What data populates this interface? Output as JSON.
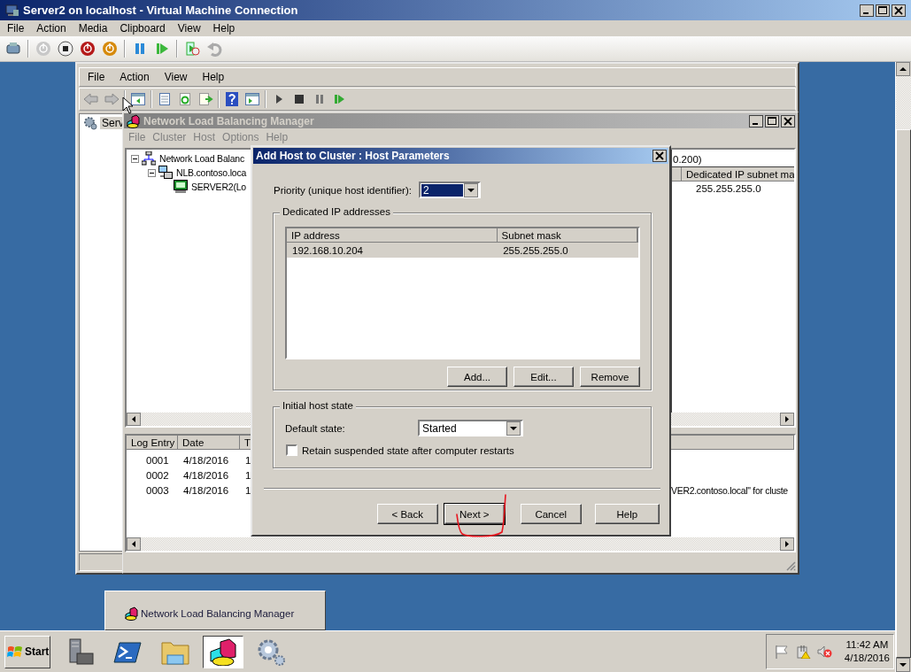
{
  "vm_window": {
    "title": "Server2 on localhost - Virtual Machine Connection",
    "menu": [
      "File",
      "Action",
      "Media",
      "Clipboard",
      "View",
      "Help"
    ]
  },
  "mmc": {
    "menu": [
      "File",
      "Action",
      "View",
      "Help"
    ],
    "tree_item": "Serv"
  },
  "nlb": {
    "title": "Network Load Balancing Manager",
    "menu": [
      "File",
      "Cluster",
      "Host",
      "Options",
      "Help"
    ],
    "tree": [
      {
        "label": "Network Load Balanc",
        "kind": "root",
        "expanded": true,
        "children": [
          {
            "label": "NLB.contoso.loca",
            "kind": "cluster",
            "expanded": true,
            "children": [
              {
                "label": "SERVER2(Lo",
                "kind": "host"
              }
            ]
          }
        ]
      }
    ],
    "detail_caption": "0.200)",
    "detail_column": "Dedicated IP subnet ma",
    "detail_value": "255.255.255.0",
    "log_columns": [
      "Log Entry",
      "Date",
      "T"
    ],
    "log_rows": [
      {
        "entry": "0001",
        "date": "4/18/2016",
        "time": "1"
      },
      {
        "entry": "0002",
        "date": "4/18/2016",
        "time": "1"
      },
      {
        "entry": "0003",
        "date": "4/18/2016",
        "time": "1",
        "message": "VER2.contoso.local\" for cluste"
      }
    ]
  },
  "dialog": {
    "title": "Add Host to Cluster :  Host Parameters",
    "priority_label": "Priority (unique host identifier):",
    "priority_value": "2",
    "dedicated_group": "Dedicated IP addresses",
    "ip_columns": [
      "IP address",
      "Subnet mask"
    ],
    "ip_rows": [
      {
        "ip": "192.168.10.204",
        "mask": "255.255.255.0",
        "selected": true
      }
    ],
    "list_buttons": [
      "Add...",
      "Edit...",
      "Remove"
    ],
    "state_group": "Initial host state",
    "default_state_label": "Default state:",
    "default_state": "Started",
    "retain": {
      "label": "Retain suspended state after computer restarts",
      "checked": false
    },
    "buttons": [
      {
        "label": "< Back",
        "default": false
      },
      {
        "label": "Next >",
        "default": true
      },
      {
        "label": "Cancel",
        "default": false
      },
      {
        "label": "Help",
        "default": false
      }
    ]
  },
  "taskbar": {
    "thumbnail": "Network Load Balancing Manager",
    "start": "Start",
    "apps": [
      {
        "kind": "server",
        "selected": false
      },
      {
        "kind": "powershell",
        "selected": false
      },
      {
        "kind": "folder",
        "selected": false
      },
      {
        "kind": "nlb",
        "selected": true
      },
      {
        "kind": "gears",
        "selected": false
      }
    ],
    "clock_time": "11:42 AM",
    "clock_date": "4/18/2016"
  }
}
